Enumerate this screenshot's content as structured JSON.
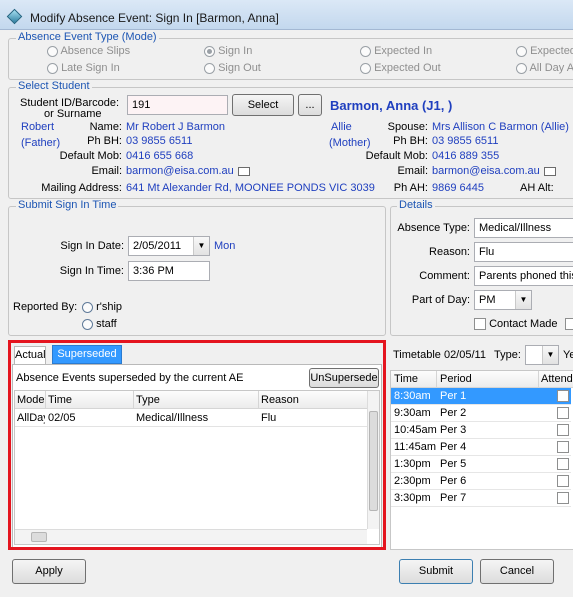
{
  "window": {
    "title": "Modify Absence Event: Sign In [Barmon, Anna]"
  },
  "event_type": {
    "legend": "Absence Event Type (Mode)",
    "options": [
      "Absence Slips",
      "Sign In",
      "Expected In",
      "Expected",
      "Late Sign In",
      "Sign Out",
      "Expected Out",
      "All Day A"
    ]
  },
  "student": {
    "legend": "Select Student",
    "id_label": "Student ID/Barcode:",
    "id_label2": "or Surname",
    "id_value": "191",
    "select_label": "Select",
    "browse_label": "...",
    "display_name": "Barmon, Anna (J1, )",
    "c1_first": "Robert",
    "c1_rel": "(Father)",
    "c1_name_label": "Name:",
    "c1_name": "Mr Robert J Barmon",
    "c1_phbh_label": "Ph BH:",
    "c1_phbh": "03 9855 6511",
    "c1_mob_label": "Default Mob:",
    "c1_mob": "0416 655 668",
    "c1_email_label": "Email:",
    "c1_email": "barmon@eisa.com.au",
    "mailing_label": "Mailing Address:",
    "mailing": "641 Mt Alexander Rd, MOONEE PONDS VIC 3039",
    "c2_first": "Allie",
    "c2_rel": "(Mother)",
    "c2_spouse_label": "Spouse:",
    "c2_spouse": "Mrs Allison C Barmon (Allie)",
    "c2_phbh_label": "Ph BH:",
    "c2_phbh": "03 9855 6511",
    "c2_mob_label": "Default Mob:",
    "c2_mob": "0416 889 355",
    "c2_email_label": "Email:",
    "c2_email": "barmon@eisa.com.au",
    "ph_ah_label": "Ph AH:",
    "ph_ah": "9869 6445",
    "ah_alt_label": "AH Alt:"
  },
  "submit": {
    "legend": "Submit Sign In Time",
    "date_label": "Sign In Date:",
    "date_value": "2/05/2011",
    "day": "Mon",
    "time_label": "Sign In Time:",
    "time_value": "3:36 PM",
    "reported_label": "Reported By:",
    "reported_options": [
      "r'ship",
      "staff"
    ]
  },
  "details": {
    "legend": "Details",
    "type_label": "Absence Type:",
    "type_value": "Medical/Illness",
    "reason_label": "Reason:",
    "reason_value": "Flu",
    "comment_label": "Comment:",
    "comment_value": "Parents phoned this",
    "part_label": "Part of Day:",
    "part_value": "PM",
    "contact_label": "Contact Made"
  },
  "superseded": {
    "tabs": [
      "Actual",
      "Superseded"
    ],
    "caption": "Absence Events superseded by the current AE",
    "unsupersede_label": "UnSupersede",
    "columns": [
      "Mode",
      "Time",
      "Type",
      "Reason"
    ],
    "rows": [
      [
        "AllDay",
        "02/05",
        "Medical/Illness",
        "Flu"
      ]
    ]
  },
  "timetable": {
    "title": "Timetable 02/05/11",
    "type_label": "Type:",
    "ye_label": "Ye",
    "columns": [
      "Time",
      "Period",
      "Attend"
    ],
    "rows": [
      [
        "8:30am",
        "Per 1"
      ],
      [
        "9:30am",
        "Per 2"
      ],
      [
        "10:45am",
        "Per 3"
      ],
      [
        "11:45am",
        "Per 4"
      ],
      [
        "1:30pm",
        "Per 5"
      ],
      [
        "2:30pm",
        "Per 6"
      ],
      [
        "3:30pm",
        "Per 7"
      ]
    ]
  },
  "footer": {
    "apply": "Apply",
    "submit": "Submit",
    "cancel": "Cancel"
  },
  "colors": {
    "accent_red": "#e4151f",
    "link_blue": "#1f3fbf",
    "selection": "#3399ff"
  }
}
